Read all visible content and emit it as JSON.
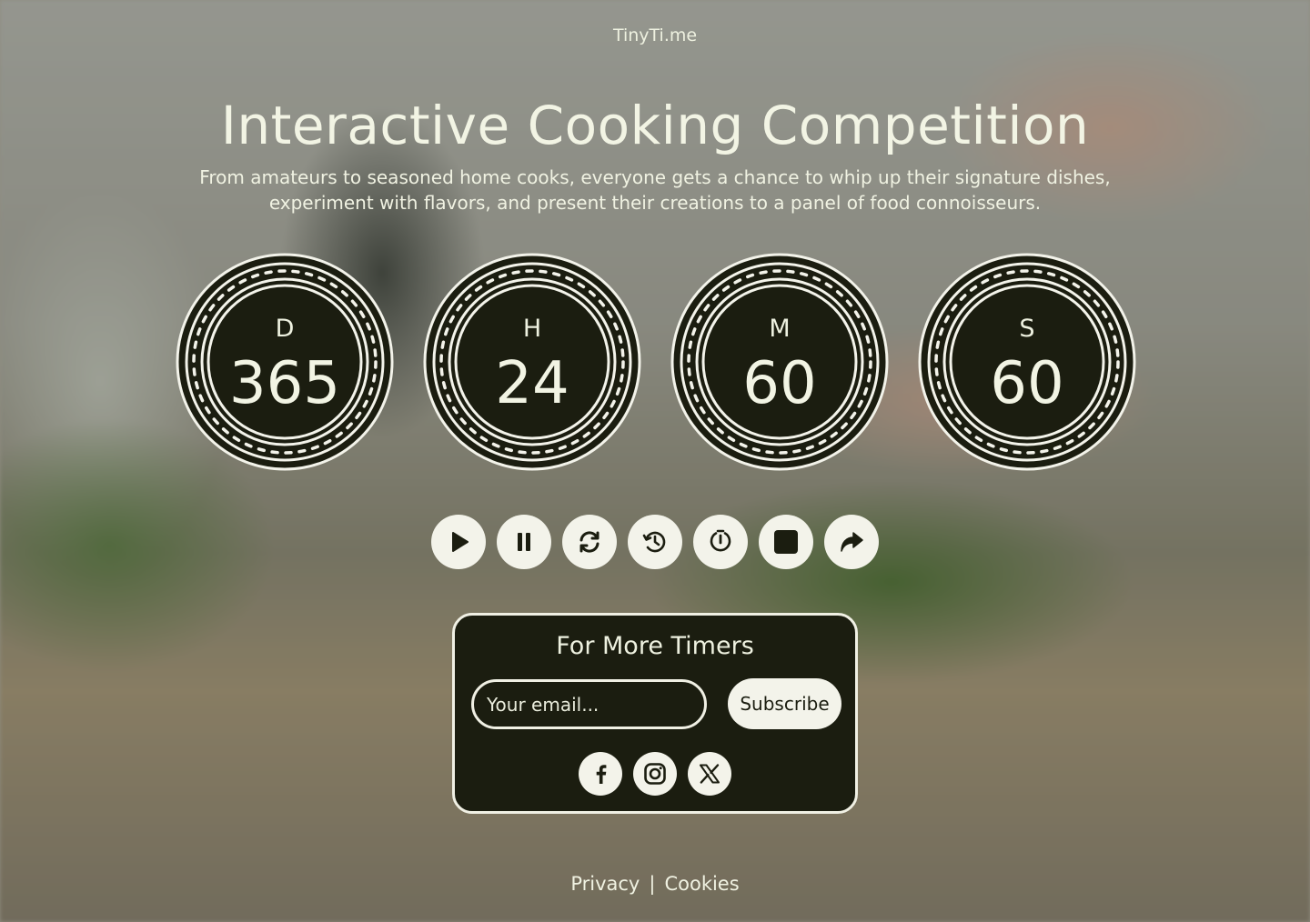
{
  "brand": "TinyTi.me",
  "title": "Interactive Cooking Competition",
  "subtitle": "From amateurs to seasoned home cooks, everyone gets a chance to whip up their signature dishes, experiment with flavors, and present their creations to a panel of food connoisseurs.",
  "countdown": [
    {
      "label": "D",
      "value": "365"
    },
    {
      "label": "H",
      "value": "24"
    },
    {
      "label": "M",
      "value": "60"
    },
    {
      "label": "S",
      "value": "60"
    }
  ],
  "controls": [
    "play-icon",
    "pause-icon",
    "refresh-icon",
    "history-icon",
    "timer-reset-icon",
    "stop-icon",
    "share-icon"
  ],
  "subscribe": {
    "title": "For More Timers",
    "email_placeholder": "Your email...",
    "button_label": "Subscribe"
  },
  "social": [
    "facebook-icon",
    "instagram-icon",
    "x-icon"
  ],
  "footer": {
    "privacy": "Privacy",
    "separator": "|",
    "cookies": "Cookies"
  },
  "colors": {
    "dark": "#1b1d10",
    "light": "#f3f3ea"
  }
}
